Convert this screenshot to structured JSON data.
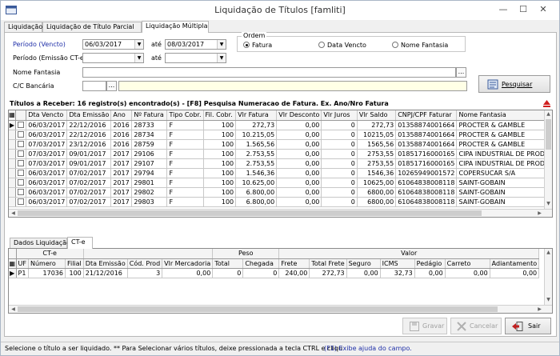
{
  "window": {
    "title": "Liquidação de Títulos [famliti]",
    "minimize": "—",
    "maximize": "☐",
    "close": "✕"
  },
  "tabs": [
    {
      "label": "Liquidação"
    },
    {
      "label": "Liquidação de Título Parcial"
    },
    {
      "label": "Liquidação Múltipla"
    }
  ],
  "filters": {
    "periodo_vencto_label": "Período (Vencto)",
    "periodo_vencto_from": "06/03/2017",
    "ate_label": "até",
    "periodo_vencto_to": "08/03/2017",
    "periodo_emissao_label": "Período (Emissão CT-e)",
    "periodo_emissao_from": "",
    "ate2_label": "até",
    "periodo_emissao_to": "",
    "nome_fantasia_label": "Nome Fantasia",
    "nome_fantasia_value": "",
    "cc_bancaria_label": "C/C Bancária",
    "cc_bancaria_value": "",
    "dots": "..."
  },
  "ordem": {
    "label": "Ordem",
    "options": [
      {
        "label": "Fatura",
        "selected": true
      },
      {
        "label": "Data Vencto",
        "selected": false
      },
      {
        "label": "Nome Fantasia",
        "selected": false
      }
    ]
  },
  "pesquisar_label": "Pesquisar",
  "titulos_header": "Títulos a Receber: 16 registro(s) encontrado(s) -   [F8] Pesquisa Numeracao de Fatura. Ex. Ano/Nro Fatura",
  "titulos_grid": {
    "columns": [
      "Dta Vencto",
      "Dta Emissão",
      "Ano",
      "Nº Fatura",
      "Tipo Cobr.",
      "Fil. Cobr.",
      "Vlr Fatura",
      "Vlr Desconto",
      "Vlr Juros",
      "Vlr Saldo",
      "CNPJ/CPF Faturar",
      "Nome Fantasia"
    ],
    "rows": [
      [
        "06/03/2017",
        "22/12/2016",
        "2016",
        "28733",
        "F",
        "100",
        "272,73",
        "0,00",
        "0",
        "272,73",
        "01358874001664",
        "PROCTER & GAMBLE"
      ],
      [
        "06/03/2017",
        "22/12/2016",
        "2016",
        "28734",
        "F",
        "100",
        "10.215,05",
        "0,00",
        "0",
        "10215,05",
        "01358874001664",
        "PROCTER & GAMBLE"
      ],
      [
        "07/03/2017",
        "23/12/2016",
        "2016",
        "28759",
        "F",
        "100",
        "1.565,56",
        "0,00",
        "0",
        "1565,56",
        "01358874001664",
        "PROCTER & GAMBLE"
      ],
      [
        "07/03/2017",
        "09/01/2017",
        "2017",
        "29106",
        "F",
        "100",
        "2.753,55",
        "0,00",
        "0",
        "2753,55",
        "01851716000165",
        "CIPA INDUSTRIAL DE PRODU"
      ],
      [
        "07/03/2017",
        "09/01/2017",
        "2017",
        "29107",
        "F",
        "100",
        "2.753,55",
        "0,00",
        "0",
        "2753,55",
        "01851716000165",
        "CIPA INDUSTRIAL DE PRODU"
      ],
      [
        "06/03/2017",
        "07/02/2017",
        "2017",
        "29794",
        "F",
        "100",
        "1.546,36",
        "0,00",
        "0",
        "1546,36",
        "10265949001572",
        "COPERSUCAR S/A"
      ],
      [
        "06/03/2017",
        "07/02/2017",
        "2017",
        "29801",
        "F",
        "100",
        "10.625,00",
        "0,00",
        "0",
        "10625,00",
        "61064838008118",
        "SAINT-GOBAIN"
      ],
      [
        "06/03/2017",
        "07/02/2017",
        "2017",
        "29802",
        "F",
        "100",
        "6.800,00",
        "0,00",
        "0",
        "6800,00",
        "61064838008118",
        "SAINT-GOBAIN"
      ],
      [
        "06/03/2017",
        "07/02/2017",
        "2017",
        "29803",
        "F",
        "100",
        "6.800,00",
        "0,00",
        "0",
        "6800,00",
        "61064838008118",
        "SAINT-GOBAIN"
      ]
    ]
  },
  "bottom_tabs": [
    {
      "label": "Dados Liquidação"
    },
    {
      "label": "CT-e"
    }
  ],
  "cte_grid": {
    "group_cte": "CT-e",
    "group_peso": "Peso",
    "group_valor": "Valor",
    "columns": [
      "UF",
      "Número",
      "Filial",
      "Dta Emissão",
      "Cód. Prod",
      "Vlr Mercadoria",
      "Total",
      "Chegada",
      "Frete",
      "Total Frete",
      "Seguro",
      "ICMS",
      "Pedágio",
      "Carreto",
      "Adiantamento",
      "Sdo Carreto"
    ],
    "rows": [
      [
        "P1",
        "17036",
        "100",
        "21/12/2016",
        "3",
        "0,00",
        "0",
        "0",
        "240,00",
        "272,73",
        "0,00",
        "32,73",
        "0,00",
        "0,00",
        "0,00",
        "0,00"
      ]
    ]
  },
  "buttons": {
    "gravar": "Gravar",
    "cancelar": "Cancelar",
    "sair": "Sair"
  },
  "status": {
    "left": "Selecione o título a ser liquidado.  ** Para Selecionar vários títulos, deixe pressionada a tecla CTRL e cliqu",
    "right": "(F1) Exibe ajuda do campo."
  },
  "colors": {
    "accent_blue": "#1f2fa8",
    "highlight_yellow": "#ffffe6",
    "red_arrow": "#d02020"
  }
}
